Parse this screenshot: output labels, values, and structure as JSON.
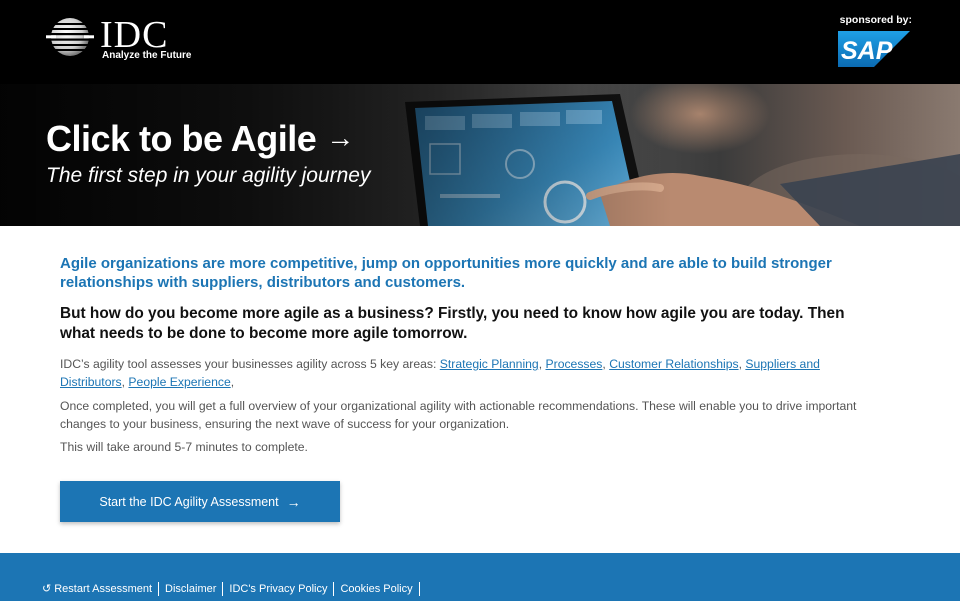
{
  "header": {
    "logo_text": "IDC",
    "logo_tagline": "Analyze the Future",
    "sponsor_label": "sponsored by:",
    "sponsor_logo_text": "SAP"
  },
  "hero": {
    "title": "Click to be Agile",
    "subtitle": "The first step in your agility journey",
    "arrow_icon": "arrow-right-icon"
  },
  "content": {
    "intro": "Agile organizations are more competitive, jump on opportunities more quickly and are able to build stronger relationships with suppliers, distributors and customers.",
    "question": "But how do you become more agile as a business? Firstly, you need to know how agile you are today. Then what needs to be done to become more agile tomorrow.",
    "areas_lead": "IDC’s agility tool assesses your businesses agility across 5 key areas: ",
    "areas": [
      "Strategic Planning",
      "Processes",
      "Customer Relationships",
      "Suppliers and Distributors",
      "People Experience"
    ],
    "overview": "Once completed, you will get a full overview of your organizational agility with actionable recommendations. These will enable you to drive important changes to your business, ensuring the next wave of success for your organization.",
    "duration": "This will take around 5-7 minutes to complete."
  },
  "cta": {
    "label": "Start the IDC Agility Assessment"
  },
  "footer": {
    "links": [
      "Restart Assessment",
      "Disclaimer",
      "IDC's Privacy Policy",
      "Cookies Policy"
    ]
  },
  "colors": {
    "brand_blue": "#1c75b4",
    "header_bg": "#000000",
    "sap_blue": "#1a8ad0"
  }
}
